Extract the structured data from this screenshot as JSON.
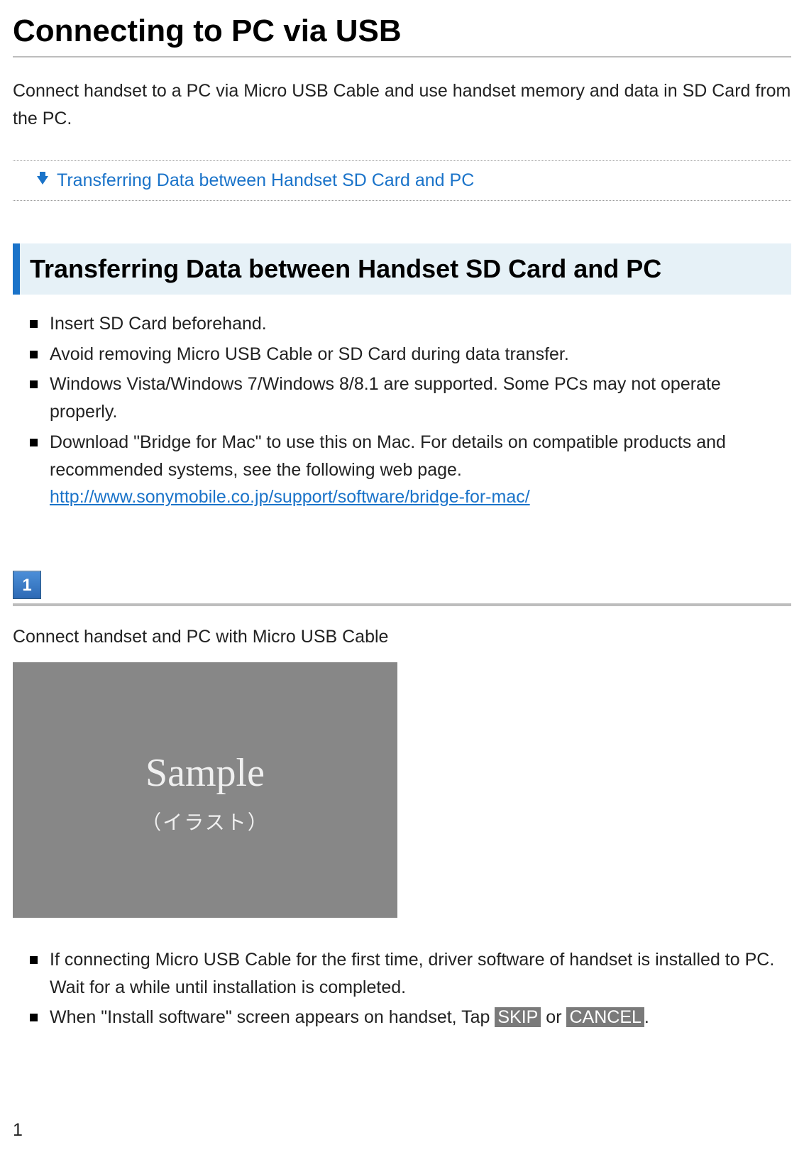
{
  "title": "Connecting to PC via USB",
  "intro": "Connect handset to a PC via Micro USB Cable and use handset memory and data in SD Card from the PC.",
  "toc_link": "Transferring Data between Handset SD Card and PC",
  "section_heading": "Transferring Data between Handset SD Card and PC",
  "notes": {
    "n1": "Insert SD Card beforehand.",
    "n2": "Avoid removing Micro USB Cable or SD Card during data transfer.",
    "n3": "Windows Vista/Windows 7/Windows 8/8.1 are supported. Some PCs may not operate properly.",
    "n4a": "Download \"Bridge for Mac\" to use this on Mac. For details on compatible products and recommended systems, see the following web page.",
    "n4_url": "http://www.sonymobile.co.jp/support/software/bridge-for-mac/"
  },
  "step": {
    "number": "1",
    "instruction": "Connect handset and PC with Micro USB Cable",
    "sample_big": "Sample",
    "sample_sub": "（イラスト）",
    "sub1": "If connecting Micro USB Cable for the first time, driver software of handset is installed to PC. Wait for a while until installation is completed.",
    "sub2_pre": "When \"Install software\" screen appears on handset, Tap ",
    "sub2_btn1": "SKIP",
    "sub2_mid": " or ",
    "sub2_btn2": "CANCEL",
    "sub2_post": "."
  },
  "page_number": "1"
}
